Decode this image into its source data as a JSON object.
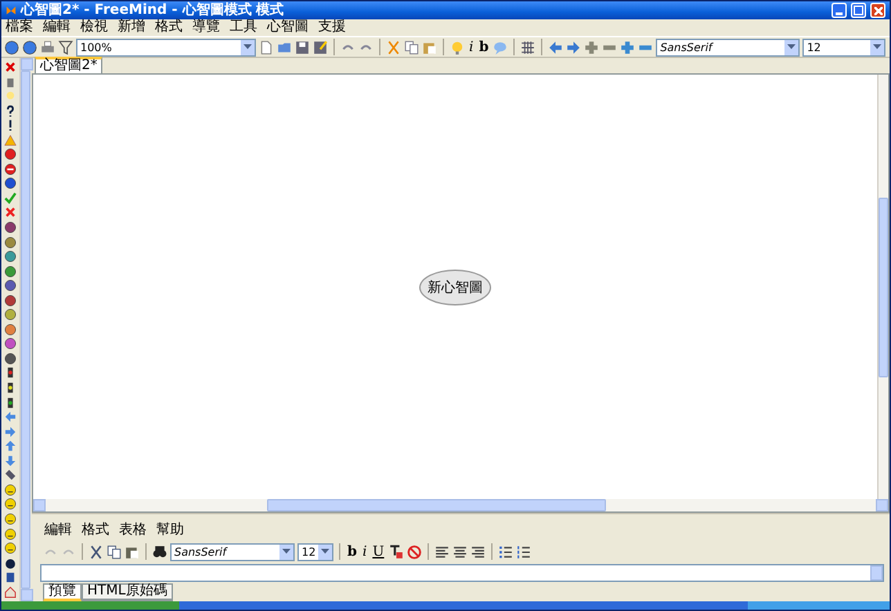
{
  "window": {
    "title": "心智圖2* - FreeMind - 心智圖模式 模式"
  },
  "menu": [
    "檔案",
    "編輯",
    "檢視",
    "新增",
    "格式",
    "導覽",
    "工具",
    "心智圖",
    "支援"
  ],
  "toolbar": {
    "zoom": "100%",
    "text_buttons": [
      "i",
      "b"
    ],
    "font": "SansSerif",
    "size": "12"
  },
  "tabs": [
    {
      "label": "心智圖2*",
      "selected": true
    }
  ],
  "map": {
    "root_node": "新心智圖"
  },
  "note_editor": {
    "menu": [
      "編輯",
      "格式",
      "表格",
      "幫助"
    ],
    "font": "SansSerif",
    "size": "12",
    "format_buttons": [
      "b",
      "i",
      "U"
    ],
    "tabs": [
      {
        "label": "預覽",
        "selected": true
      },
      {
        "label": "HTML原始碼",
        "selected": false
      }
    ]
  }
}
